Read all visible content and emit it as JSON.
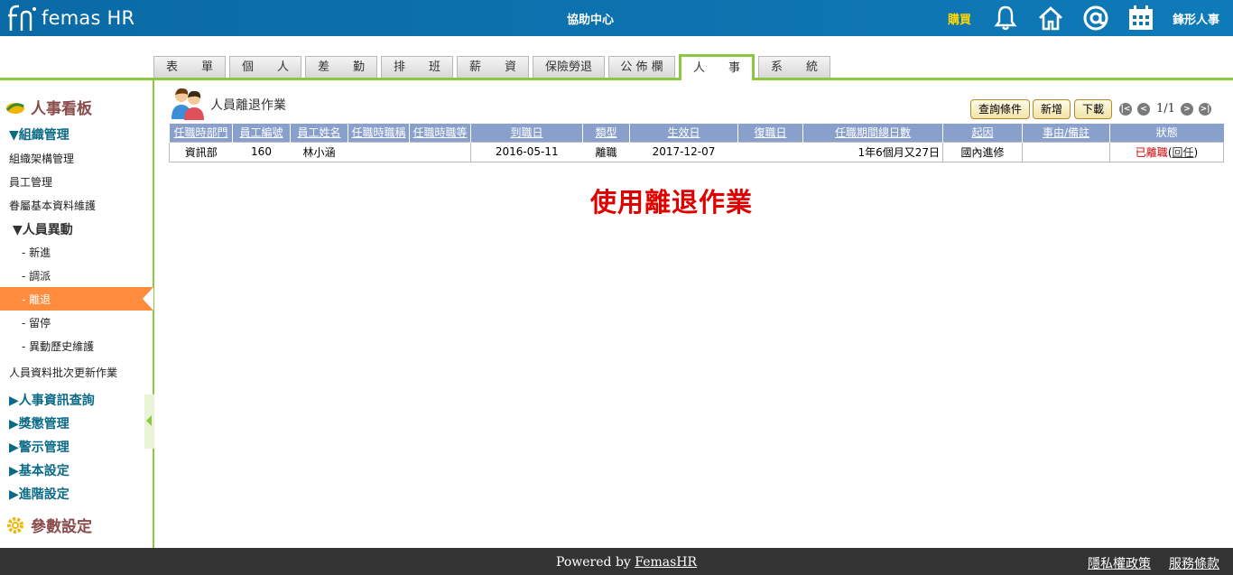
{
  "header": {
    "logo_text": "femas HR",
    "help_center": "協助中心",
    "buy": "購買",
    "company": "鋒形人事",
    "icons": [
      "bell-icon",
      "home-icon",
      "at-icon",
      "calendar-icon"
    ]
  },
  "tabs": [
    {
      "label": "表　　單"
    },
    {
      "label": "個　　人"
    },
    {
      "label": "差　　勤"
    },
    {
      "label": "排　　班"
    },
    {
      "label": "薪　　資"
    },
    {
      "label": "保險勞退"
    },
    {
      "label": "公 佈 欄"
    },
    {
      "label": "人　　事"
    },
    {
      "label": "系　　統"
    }
  ],
  "sidebar": {
    "heading": "人事看板",
    "org_group": "▼組織管理",
    "org_items": [
      "組織架構管理",
      "員工管理",
      "眷屬基本資料維護"
    ],
    "movement_group": "▼人員異動",
    "movement_items": [
      "- 新進",
      "- 調派",
      "- 離退",
      "- 留停",
      "- 異動歷史維護"
    ],
    "batch_item": "人員資料批次更新作業",
    "groups": [
      "▶人事資訊查詢",
      "▶獎懲管理",
      "▶警示管理",
      "▶基本設定",
      "▶進階設定"
    ],
    "param_heading": "參數設定"
  },
  "main": {
    "title": "人員離退作業",
    "buttons": {
      "query": "查詢條件",
      "add": "新增",
      "download": "下載"
    },
    "pager": {
      "first": "|<",
      "prev": "<",
      "text": "1/1",
      "next": ">",
      "last": ">|"
    },
    "columns": [
      "任職時部門",
      "員工編號",
      "員工姓名",
      "任職時職稱",
      "任職時職等",
      "到職日",
      "類型",
      "生效日",
      "復職日",
      "任職期間總日數",
      "起因",
      "事由/備註",
      "狀態"
    ],
    "rows": [
      {
        "dept": "資訊部",
        "emp_no": "160",
        "name": "林小涵",
        "title": "",
        "grade": "",
        "hire_date": "2016-05-11",
        "type": "離職",
        "effective_date": "2017-12-07",
        "rehire_date": "",
        "total_days": "1年6個月又27日",
        "cause": "國內進修",
        "reason": "",
        "status": "已離職",
        "status_link": "回任"
      }
    ],
    "banner": "使用離退作業"
  },
  "footer": {
    "powered_prefix": "Powered by ",
    "powered_link": "FemasHR",
    "privacy": "隱私權政策",
    "terms": "服務條款"
  }
}
